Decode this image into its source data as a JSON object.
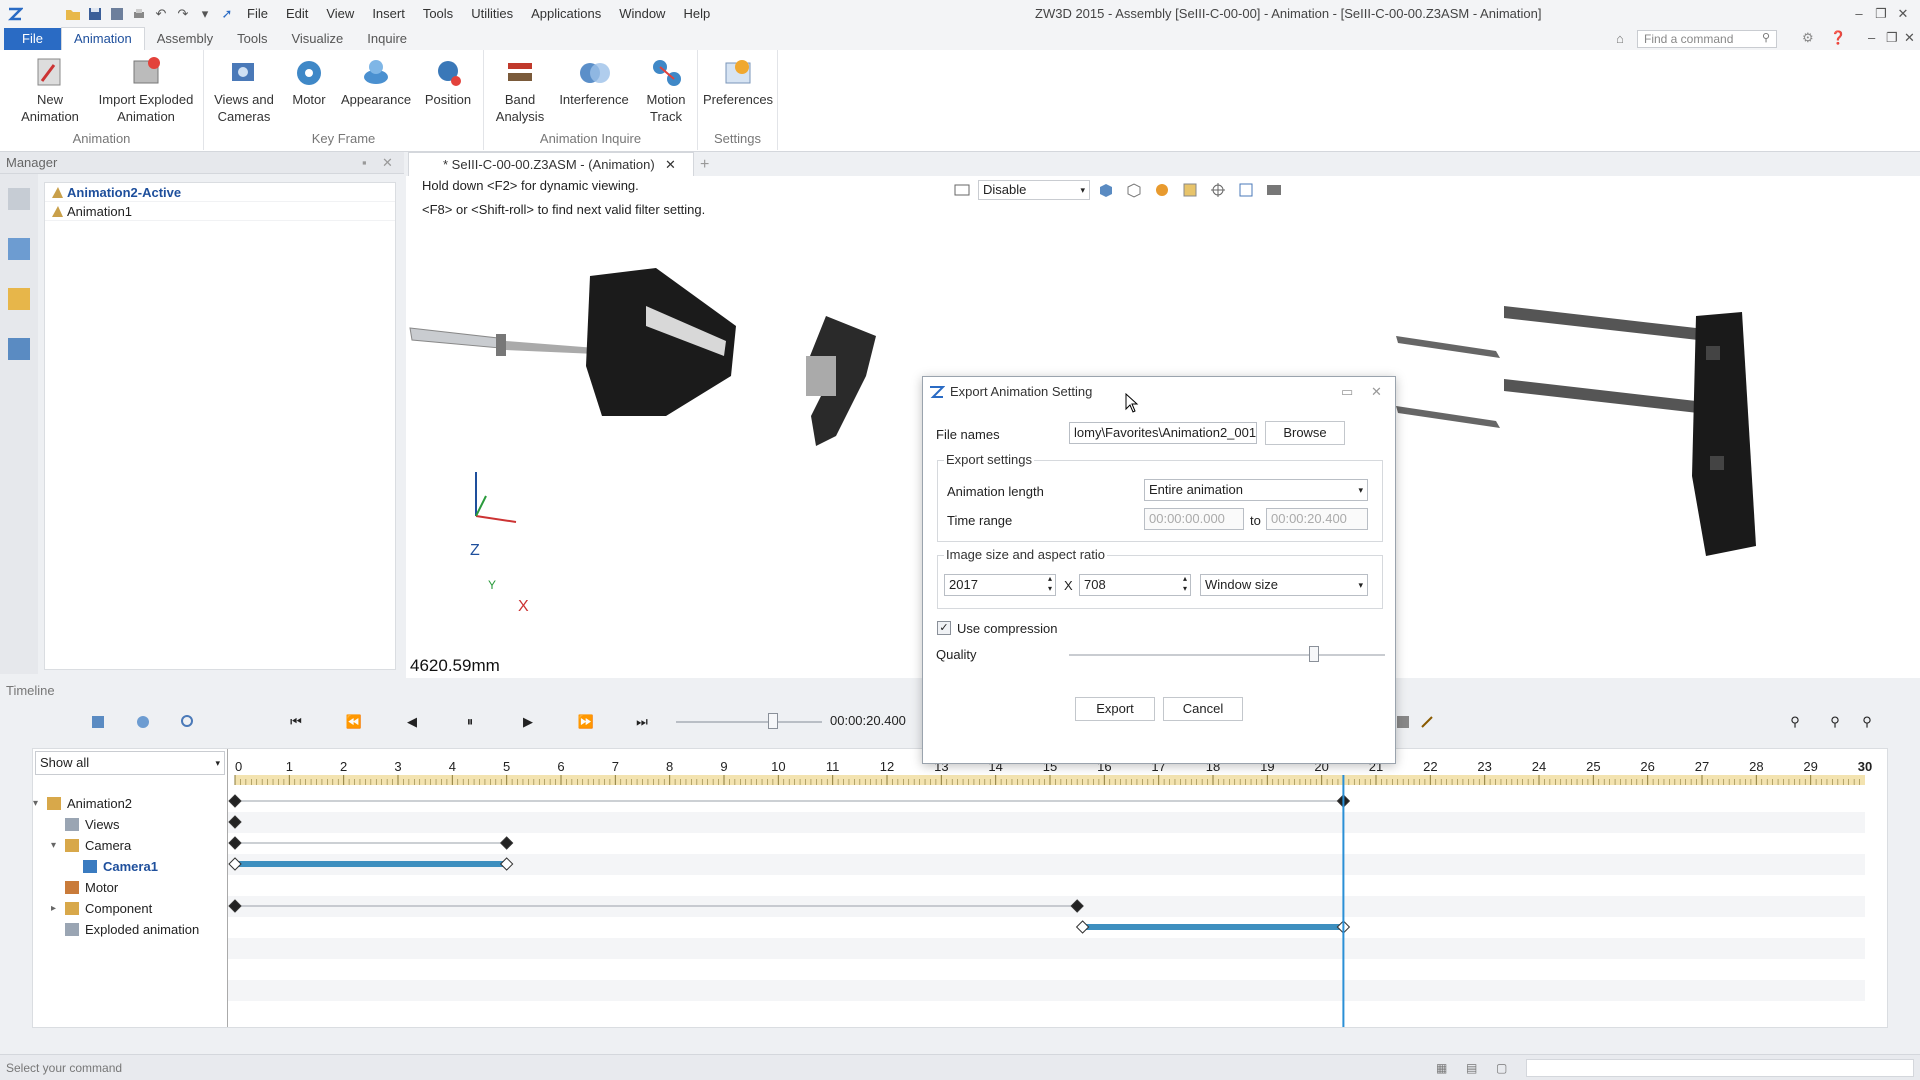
{
  "titlebar": {
    "menus": [
      "File",
      "Edit",
      "View",
      "Insert",
      "Tools",
      "Utilities",
      "Applications",
      "Window",
      "Help"
    ],
    "doc_title": "ZW3D 2015 - Assembly [SeIII-C-00-00] - Animation - [SeIII-C-00-00.Z3ASM - Animation]"
  },
  "ribbon_tabs": [
    "File",
    "Animation",
    "Assembly",
    "Tools",
    "Visualize",
    "Inquire"
  ],
  "search": {
    "placeholder": "Find a command"
  },
  "ribbon": {
    "groups": [
      {
        "label": "Animation",
        "buttons": [
          "New Animation",
          "Import Exploded Animation"
        ]
      },
      {
        "label": "Key Frame",
        "buttons": [
          "Views and Cameras",
          "Motor",
          "Appearance",
          "Position"
        ]
      },
      {
        "label": "Animation Inquire",
        "buttons": [
          "Band Analysis",
          "Interference",
          "Motion Track"
        ]
      },
      {
        "label": "Settings",
        "buttons": [
          "Preferences"
        ]
      }
    ]
  },
  "manager": {
    "title": "Manager",
    "items": [
      "Animation2-Active",
      "Animation1"
    ]
  },
  "viewport": {
    "tab_title": "* SeIII-C-00-00.Z3ASM - (Animation)",
    "hint1": "Hold down <F2> for dynamic viewing.",
    "hint2": "<F8> or <Shift-roll> to find next valid filter setting.",
    "filter_value": "Disable",
    "axis_z": "Z",
    "axis_y": "Y",
    "axis_x": "X",
    "distance": "4620.59mm"
  },
  "dialog": {
    "title": "Export Animation Setting",
    "file_label": "File names",
    "file_value": "lomy\\Favorites\\Animation2_001.mp4",
    "browse": "Browse",
    "export_settings": "Export settings",
    "anim_length_label": "Animation length",
    "anim_length_value": "Entire animation",
    "time_range_label": "Time range",
    "time_from": "00:00:00.000",
    "time_to_label": "to",
    "time_to": "00:00:20.400",
    "image_size_label": "Image size and aspect ratio",
    "width": "2017",
    "x_label": "X",
    "height": "708",
    "size_mode": "Window size",
    "compression_label": "Use compression",
    "compression_checked": true,
    "quality_label": "Quality",
    "quality_level": 0.8,
    "export_btn": "Export",
    "cancel_btn": "Cancel"
  },
  "timeline": {
    "title": "Timeline",
    "time": "00:00:20.400",
    "filter": "Show all",
    "ruler_max": 30,
    "current_time": 20.4,
    "tree": [
      {
        "label": "Animation2",
        "level": 0,
        "expand": "v"
      },
      {
        "label": "Views",
        "level": 1,
        "expand": ""
      },
      {
        "label": "Camera",
        "level": 1,
        "expand": "v"
      },
      {
        "label": "Camera1",
        "level": 2,
        "expand": "",
        "highlight": true
      },
      {
        "label": "Motor",
        "level": 1,
        "expand": ""
      },
      {
        "label": "Component",
        "level": 1,
        "expand": ">"
      },
      {
        "label": "Exploded animation",
        "level": 1,
        "expand": ""
      }
    ],
    "tracks": [
      {
        "row": 0,
        "keys": [
          0,
          20.4
        ],
        "bar": null
      },
      {
        "row": 1,
        "keys": [
          0
        ],
        "bar": null
      },
      {
        "row": 2,
        "keys": [
          0,
          5
        ],
        "bar": null
      },
      {
        "row": 3,
        "keys": [
          0,
          5
        ],
        "bar": [
          0,
          5
        ]
      },
      {
        "row": 5,
        "keys": [
          0,
          15.5
        ],
        "bar": null
      },
      {
        "row": 6,
        "keys": [
          15.6,
          20.4
        ],
        "bar": [
          15.6,
          20.4
        ]
      }
    ]
  },
  "status": {
    "text": "Select your command"
  },
  "colors": {
    "accent": "#2a6bc4",
    "track_bar": "#3d8fbf",
    "playhead": "#2a8fd6"
  }
}
